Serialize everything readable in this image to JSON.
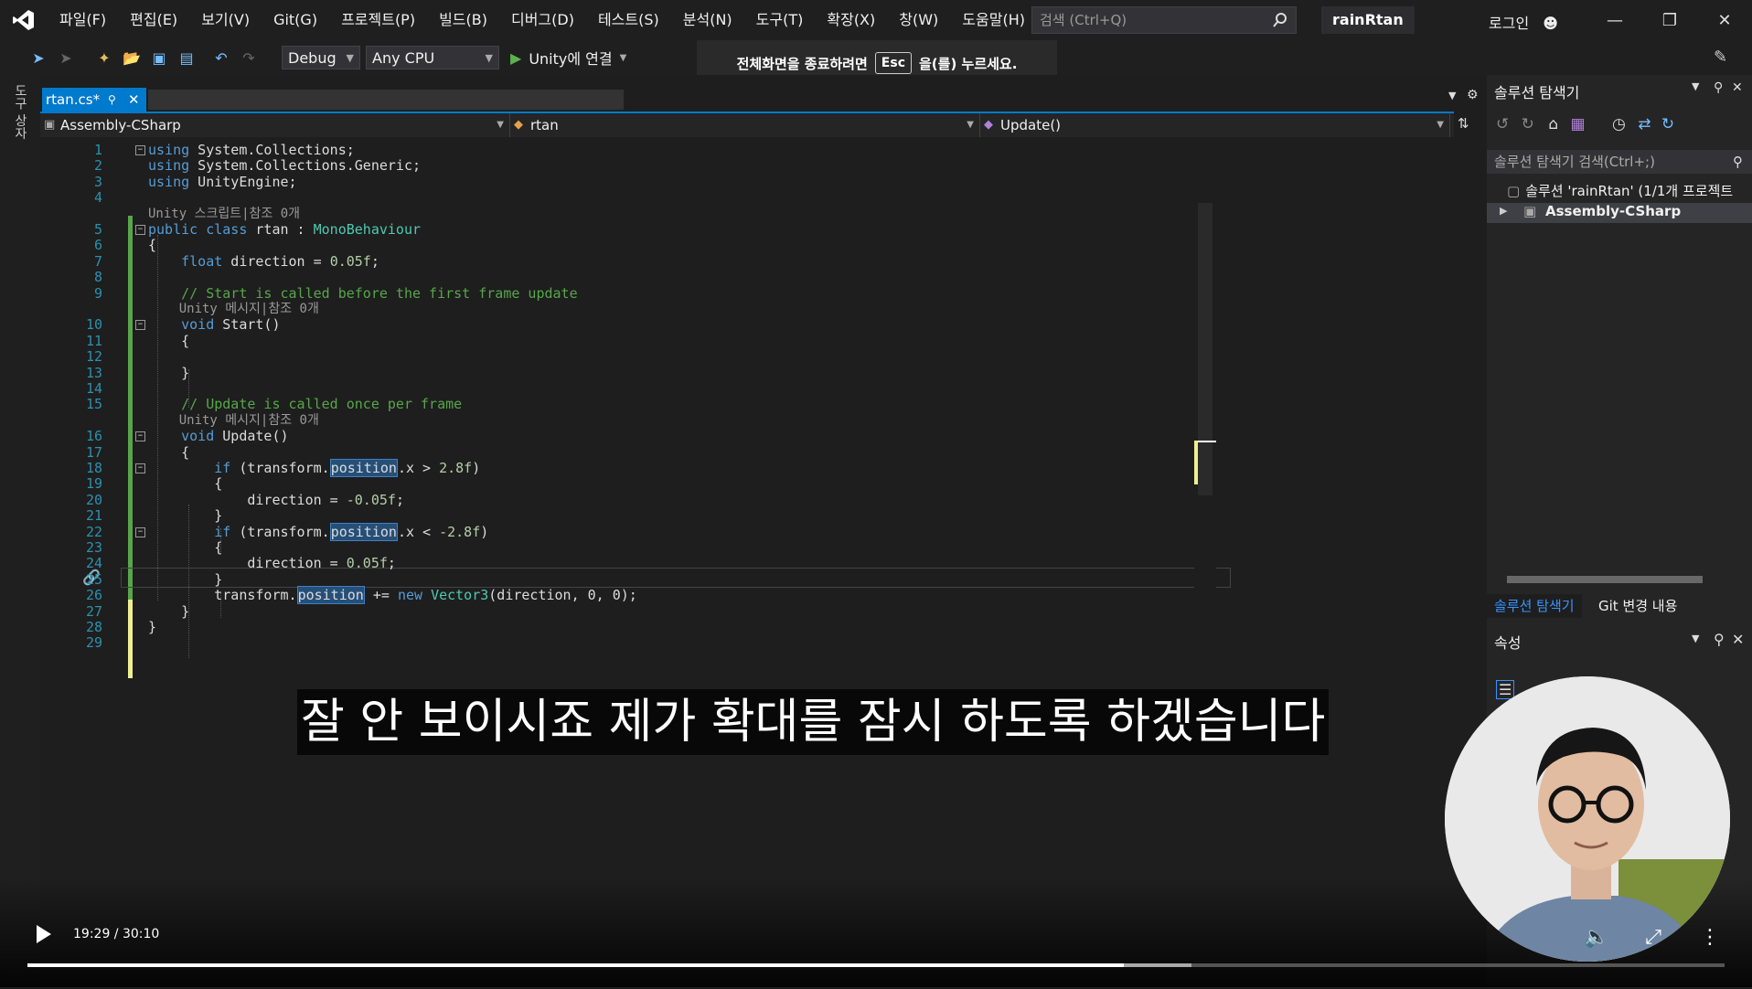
{
  "menu": [
    "파일(F)",
    "편집(E)",
    "보기(V)",
    "Git(G)",
    "프로젝트(P)",
    "빌드(B)",
    "디버그(D)",
    "테스트(S)",
    "분석(N)",
    "도구(T)",
    "확장(X)",
    "창(W)",
    "도움말(H)"
  ],
  "search": {
    "placeholder": "검색 (Ctrl+Q)"
  },
  "solution_name": "rainRtan",
  "login": "로그인",
  "toolbar": {
    "config": "Debug",
    "platform": "Any CPU",
    "run_label": "Unity에 연결"
  },
  "esc_banner": {
    "before": "전체화면을 종료하려면",
    "key": "Esc",
    "after": "을(를) 누르세요."
  },
  "left_strip_label": "도구 상자",
  "tab": {
    "name": "rtan.cs*"
  },
  "nav": {
    "project": "Assembly-CSharp",
    "class": "rtan",
    "member": "Update()"
  },
  "code_lines": [
    {
      "n": "1",
      "t": "using System.Collections;"
    },
    {
      "n": "2",
      "t": "using System.Collections.Generic;"
    },
    {
      "n": "3",
      "t": "using UnityEngine;"
    },
    {
      "n": "4",
      "t": ""
    },
    {
      "n": "",
      "t": "Unity 스크립트|참조 0개",
      "lens": true
    },
    {
      "n": "5",
      "t": "public class rtan : MonoBehaviour"
    },
    {
      "n": "6",
      "t": "{"
    },
    {
      "n": "7",
      "t": "    float direction = 0.05f;"
    },
    {
      "n": "8",
      "t": ""
    },
    {
      "n": "9",
      "t": "    // Start is called before the first frame update"
    },
    {
      "n": "",
      "t": "    Unity 메시지|참조 0개",
      "lens": true
    },
    {
      "n": "10",
      "t": "    void Start()"
    },
    {
      "n": "11",
      "t": "    {"
    },
    {
      "n": "12",
      "t": ""
    },
    {
      "n": "13",
      "t": "    }"
    },
    {
      "n": "14",
      "t": ""
    },
    {
      "n": "15",
      "t": "    // Update is called once per frame"
    },
    {
      "n": "",
      "t": "    Unity 메시지|참조 0개",
      "lens": true
    },
    {
      "n": "16",
      "t": "    void Update()"
    },
    {
      "n": "17",
      "t": "    {"
    },
    {
      "n": "18",
      "t": "        if (transform.position.x > 2.8f)"
    },
    {
      "n": "19",
      "t": "        {"
    },
    {
      "n": "20",
      "t": "            direction = -0.05f;"
    },
    {
      "n": "21",
      "t": "        }"
    },
    {
      "n": "22",
      "t": "        if (transform.position.x < -2.8f)"
    },
    {
      "n": "23",
      "t": "        {"
    },
    {
      "n": "24",
      "t": "            direction = 0.05f;"
    },
    {
      "n": "25",
      "t": "        }"
    },
    {
      "n": "26",
      "t": "        transform.position += new Vector3(direction, 0, 0);"
    },
    {
      "n": "27",
      "t": "    }"
    },
    {
      "n": "28",
      "t": "}"
    },
    {
      "n": "29",
      "t": ""
    }
  ],
  "solution_explorer": {
    "title": "솔루션 탐색기",
    "search": "솔루션 탐색기 검색(Ctrl+;)",
    "solution": "솔루션 'rainRtan' (1/1개 프로젝트",
    "project": "Assembly-CSharp",
    "tab1": "솔루션 탐색기",
    "tab2": "Git 변경 내용"
  },
  "properties": {
    "title": "속성"
  },
  "video": {
    "time": "19:29 / 30:10",
    "progress": 0.646,
    "buffered": 0.686
  },
  "caption": "잘 안 보이시죠 제가 확대를 잠시 하도록 하겠습니다"
}
